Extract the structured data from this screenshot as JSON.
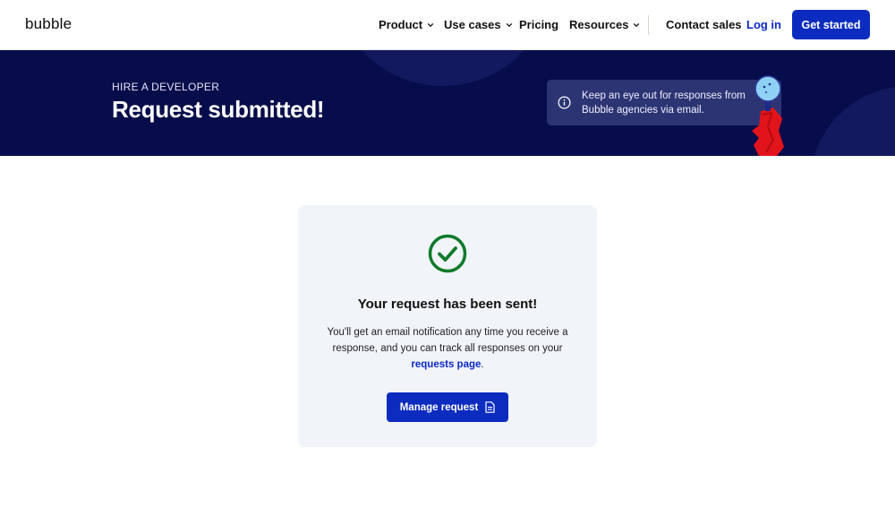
{
  "nav": {
    "logo": "bubble",
    "items": [
      {
        "label": "Product",
        "has_dropdown": true
      },
      {
        "label": "Use cases",
        "has_dropdown": true
      },
      {
        "label": "Pricing",
        "has_dropdown": false
      },
      {
        "label": "Resources",
        "has_dropdown": true
      }
    ],
    "contact_sales": "Contact sales",
    "login": "Log in",
    "get_started": "Get started"
  },
  "hero": {
    "eyebrow": "HIRE A DEVELOPER",
    "title": "Request submitted!",
    "notice": "Keep an eye out for responses from Bubble agencies via email."
  },
  "card": {
    "title": "Your request has been sent!",
    "body_prefix": "You'll get an email notification any time you receive a response, and you can track all responses on your ",
    "link_text": "requests page",
    "body_suffix": ".",
    "button_label": "Manage request"
  },
  "colors": {
    "brand_blue": "#0c2cbf",
    "hero_bg": "#070c4a",
    "success_green": "#0e7a2a",
    "card_bg": "#f1f4f9"
  },
  "icons": {
    "chevron": "chevron-down-icon",
    "info": "info-icon",
    "success": "check-circle-icon",
    "document": "document-icon",
    "mascot": "mascot-illustration"
  }
}
